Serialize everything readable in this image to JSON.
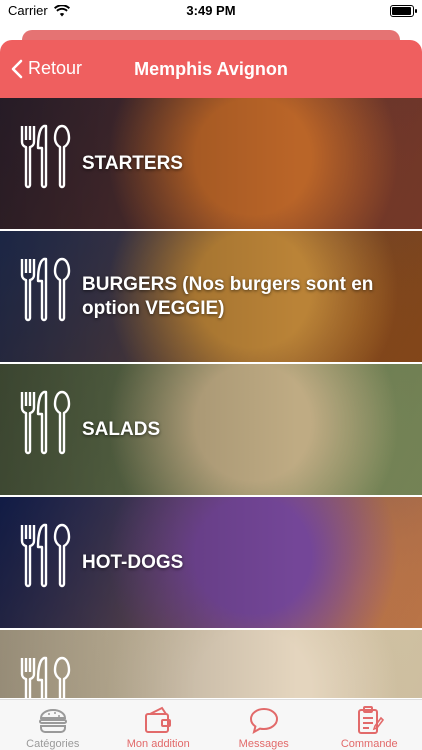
{
  "status_bar": {
    "carrier": "Carrier",
    "time": "3:49 PM"
  },
  "nav": {
    "back_label": "Retour",
    "title": "Memphis Avignon"
  },
  "categories": [
    {
      "label": "STARTERS",
      "colors": [
        "#3a2a3a",
        "#c46a2a",
        "#7a3b2a"
      ]
    },
    {
      "label": "BURGERS (Nos burgers sont en option VEGGIE)",
      "colors": [
        "#2a3a6a",
        "#c48a3a",
        "#8a4a1a"
      ]
    },
    {
      "label": "SALADS",
      "colors": [
        "#5a6a4a",
        "#c9b48a",
        "#7a8a5a"
      ]
    },
    {
      "label": "HOT-DOGS",
      "colors": [
        "#1a2a6a",
        "#7a4aa0",
        "#c47a4a"
      ]
    },
    {
      "label": "",
      "colors": [
        "#e8d8b8",
        "#f0e0c8",
        "#d8c8a8"
      ]
    }
  ],
  "tabbar": {
    "items": [
      {
        "label": "Catégories",
        "icon": "burger-icon",
        "active": true
      },
      {
        "label": "Mon addition",
        "icon": "wallet-icon",
        "active": false
      },
      {
        "label": "Messages",
        "icon": "chat-bubble-icon",
        "active": false
      },
      {
        "label": "Commande",
        "icon": "order-clipboard-icon",
        "active": false
      }
    ]
  },
  "colors": {
    "accent": "#ef5f5f",
    "tab_active": "#9a9a9a",
    "tab_inactive": "#e26a6a"
  }
}
